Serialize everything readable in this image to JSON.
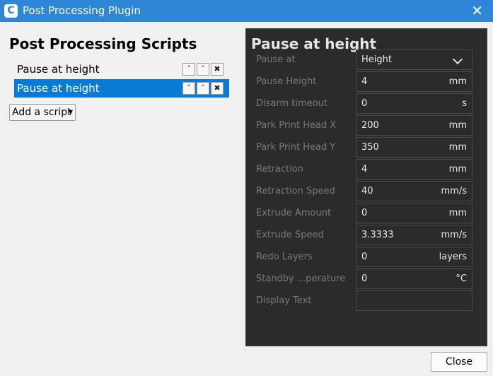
{
  "window": {
    "title": "Post Processing Plugin",
    "app_icon_letter": "C"
  },
  "left": {
    "title": "Post Processing Scripts",
    "scripts": [
      {
        "label": "Pause at height"
      },
      {
        "label": "Pause at height",
        "selected": true
      }
    ],
    "add_script_label": "Add a script"
  },
  "panel": {
    "title": "Pause at height",
    "fields": [
      {
        "label": "Pause at",
        "value": "Height",
        "unit": "",
        "type": "dropdown"
      },
      {
        "label": "Pause Height",
        "value": "4",
        "unit": "mm"
      },
      {
        "label": "Disarm timeout",
        "value": "0",
        "unit": "s"
      },
      {
        "label": "Park Print Head X",
        "value": "200",
        "unit": "mm"
      },
      {
        "label": "Park Print Head Y",
        "value": "350",
        "unit": "mm"
      },
      {
        "label": "Retraction",
        "value": "4",
        "unit": "mm"
      },
      {
        "label": "Retraction Speed",
        "value": "40",
        "unit": "mm/s"
      },
      {
        "label": "Extrude Amount",
        "value": "0",
        "unit": "mm"
      },
      {
        "label": "Extrude Speed",
        "value": "3.3333",
        "unit": "mm/s"
      },
      {
        "label": "Redo Layers",
        "value": "0",
        "unit": "layers"
      },
      {
        "label": "Standby ...perature",
        "value": "0",
        "unit": "°C"
      },
      {
        "label": "Display Text",
        "value": "",
        "unit": ""
      }
    ]
  },
  "footer": {
    "close_label": "Close"
  },
  "colors": {
    "accent": "#2e86d6",
    "selection": "#0a7ad6",
    "panel_bg": "#2b2b2b"
  }
}
